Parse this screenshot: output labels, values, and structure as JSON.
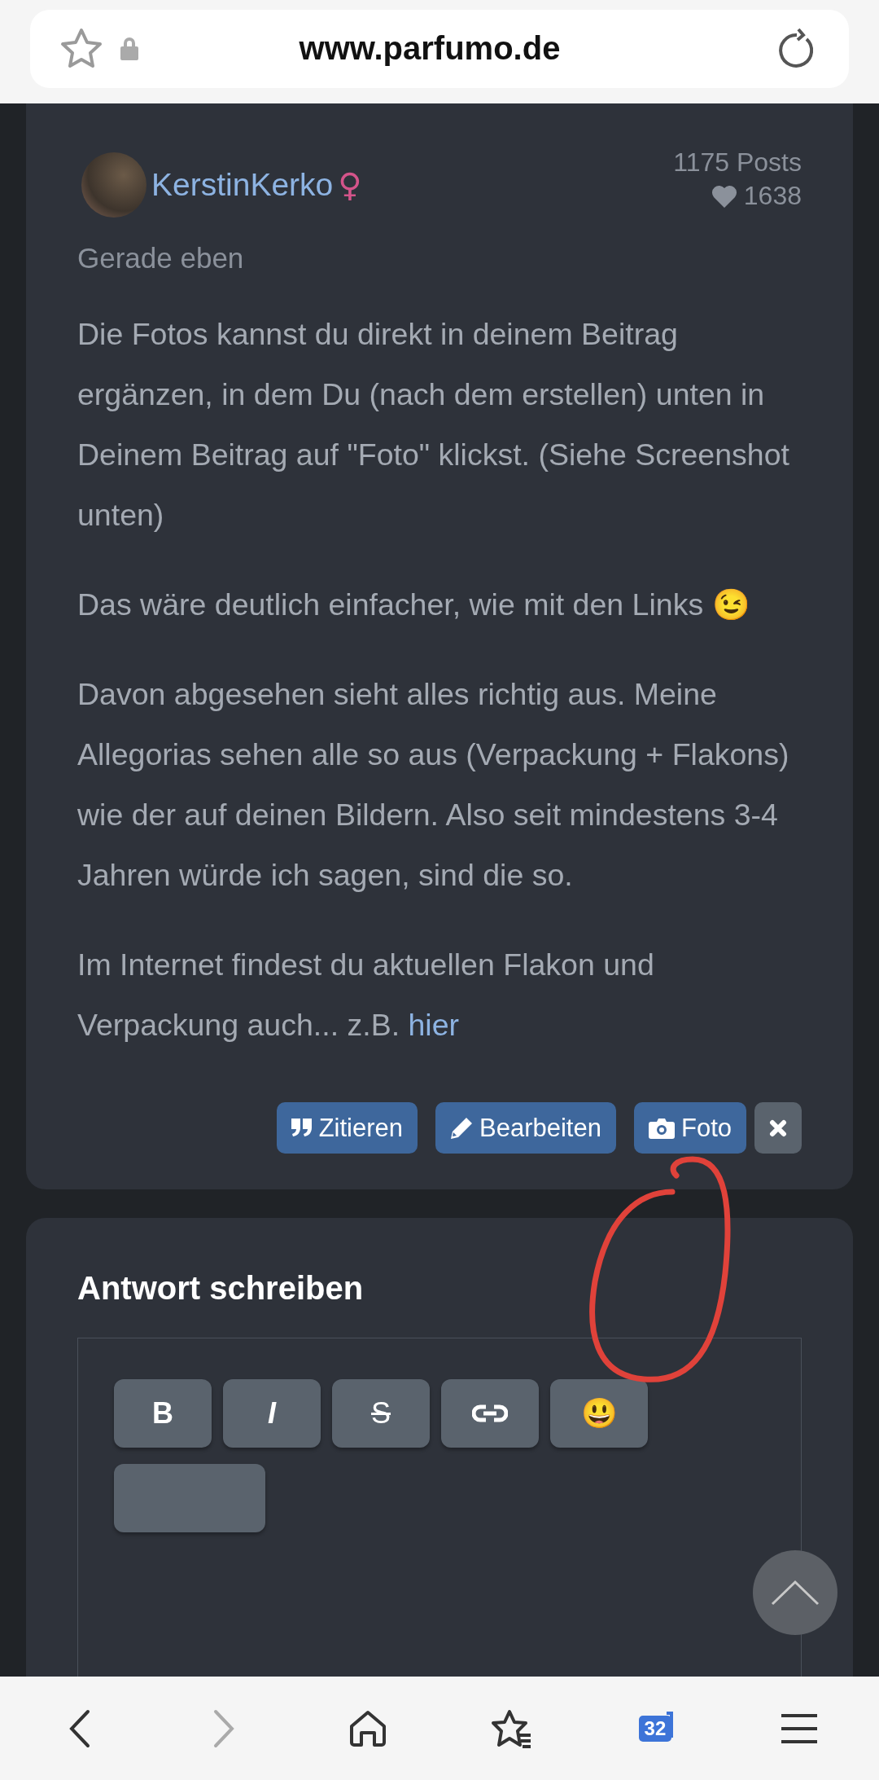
{
  "browser": {
    "url": "www.parfumo.de",
    "tab_count": "32"
  },
  "post": {
    "author": "KerstinKerko",
    "gender_symbol": "♀",
    "posts": "1175 Posts",
    "likes": "1638",
    "time": "Gerade eben",
    "paragraphs": [
      {
        "text": "Die Fotos kannst du direkt in deinem Beitrag ergänzen, in dem Du (nach dem erstellen) unten in Deinem Beitrag auf \"Foto\" klickst. (Siehe Screenshot unten)"
      },
      {
        "text": "Das wäre deutlich einfacher, wie mit den Links 😉"
      },
      {
        "text": "Davon abgesehen sieht alles richtig aus. Meine Allegorias sehen alle so aus (Verpackung + Flakons) wie der auf deinen Bildern. Also seit mindestens 3-4 Jahren würde ich sagen, sind die so."
      },
      {
        "text": "Im Internet findest du aktuellen Flakon und Verpackung auch... z.B.",
        "link": "hier"
      }
    ],
    "actions": [
      {
        "kind": "quote",
        "label": "Zitieren"
      },
      {
        "kind": "edit",
        "label": "Bearbeiten"
      },
      {
        "kind": "photo",
        "label": "Foto"
      },
      {
        "kind": "delete"
      }
    ]
  },
  "reply": {
    "title": "Antwort schreiben",
    "toolbar": [
      {
        "kind": "bold",
        "label": "B"
      },
      {
        "kind": "italic",
        "label": "I"
      },
      {
        "kind": "strike",
        "label": "S"
      },
      {
        "kind": "link"
      },
      {
        "kind": "emoji",
        "label": "😃"
      },
      {
        "kind": "more"
      }
    ]
  }
}
